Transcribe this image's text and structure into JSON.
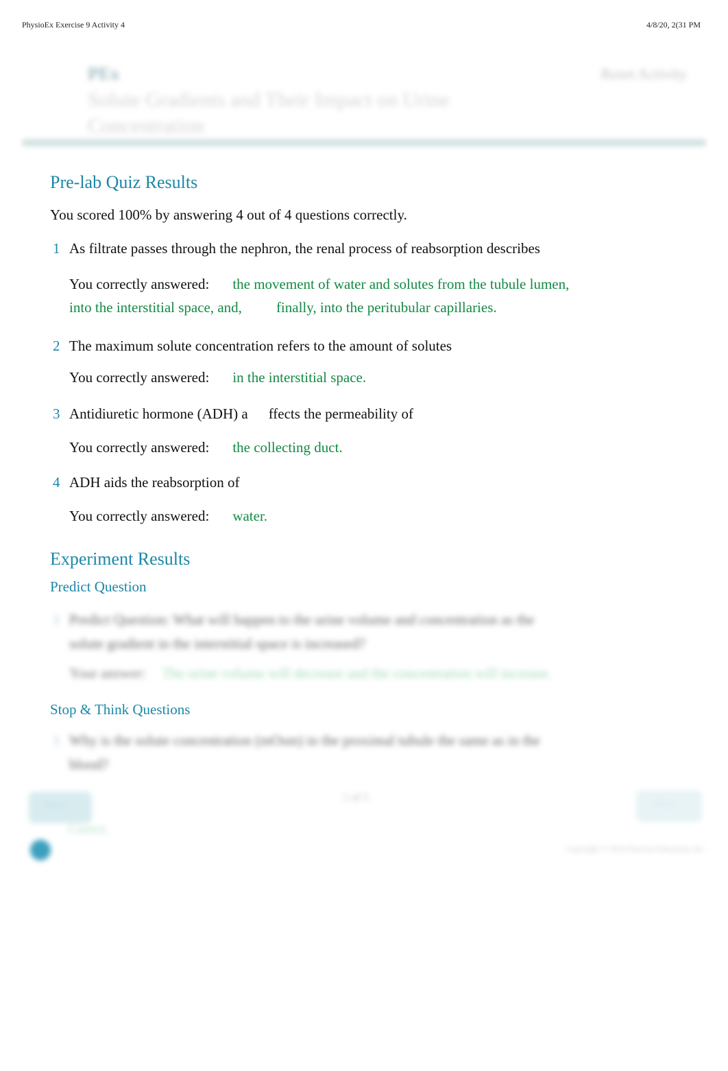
{
  "print_header": {
    "title": "PhysioEx Exercise 9 Activity 4",
    "datetime": "4/8/20, 2(31 PM"
  },
  "app_header": {
    "logo_text": "PEx",
    "activity_title": "Solute Gradients and Their Impact on Urine Concentration",
    "reset_label": "Reset Activity"
  },
  "prelab": {
    "heading": "Pre-lab Quiz Results",
    "score_text": "You scored 100% by answering 4 out of 4 questions correctly.",
    "answer_label": "You correctly answered:",
    "questions": [
      {
        "number": "1",
        "text": "As filtrate passes through the nephron, the renal process of reabsorption describes",
        "answer_line1": "the movement of water and solutes from the tubule lumen,",
        "answer_line2a": "into the interstitial space, and,",
        "answer_line2b": "finally, into the peritubular capillaries."
      },
      {
        "number": "2",
        "text": "The maximum solute concentration refers to the amount of solutes",
        "answer": "in the interstitial space."
      },
      {
        "number": "3",
        "text_a": "Antidiuretic hormone (ADH) a",
        "text_b": "ffects the permeability of",
        "answer": "the collecting duct."
      },
      {
        "number": "4",
        "text": "ADH aids the reabsorption of",
        "answer": "water."
      }
    ]
  },
  "experiment": {
    "heading": "Experiment Results",
    "predict": {
      "heading": "Predict Question",
      "number": "1",
      "question": "Predict Question: What will happen to the urine volume and concentration as the solute gradient in the interstitial space is increased?",
      "answer_label": "Your answer:",
      "answer": "The urine volume will decrease and the concentration will increase."
    },
    "stop_think": {
      "heading": "Stop & Think Questions",
      "number": "1",
      "question": "Why is the solute concentration (mOsm) in the proximal tubule the same as in the blood?"
    }
  },
  "footer": {
    "prev_label": "Prev",
    "next_label": "Next",
    "page_indicator": "1 of 5",
    "green_text": "Correct.",
    "copyright": "Copyright © 2016 Pearson Education, Inc."
  },
  "colors": {
    "heading_accent": "#1b87a6",
    "answer_green": "#138a44",
    "body_text": "#111111"
  }
}
